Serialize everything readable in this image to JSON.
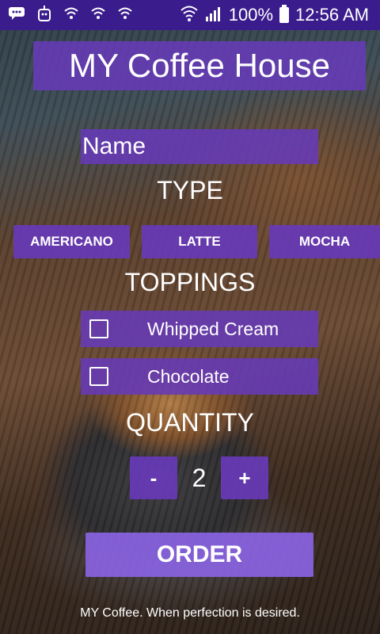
{
  "status_bar": {
    "left_icons": [
      "chat-icon",
      "robot-icon",
      "wifi-hotspot-icon",
      "wifi-hotspot-icon",
      "wifi-hotspot-icon"
    ],
    "battery": "100%",
    "time": "12:56 AM"
  },
  "app": {
    "title": "MY Coffee House",
    "name_placeholder": "Name",
    "type_label": "TYPE",
    "types": [
      "AMERICANO",
      "LATTE",
      "MOCHA"
    ],
    "toppings_label": "TOPPINGS",
    "toppings": [
      {
        "label": "Whipped Cream",
        "checked": false
      },
      {
        "label": "Chocolate",
        "checked": false
      }
    ],
    "quantity_label": "QUANTITY",
    "minus_label": "-",
    "plus_label": "+",
    "quantity": "2",
    "order_label": "ORDER",
    "footer": "MY Coffee. When perfection is desired."
  },
  "colors": {
    "status_bar": "#3a1c8c",
    "primary": "#673ab7",
    "order_button": "#8c64e6"
  }
}
